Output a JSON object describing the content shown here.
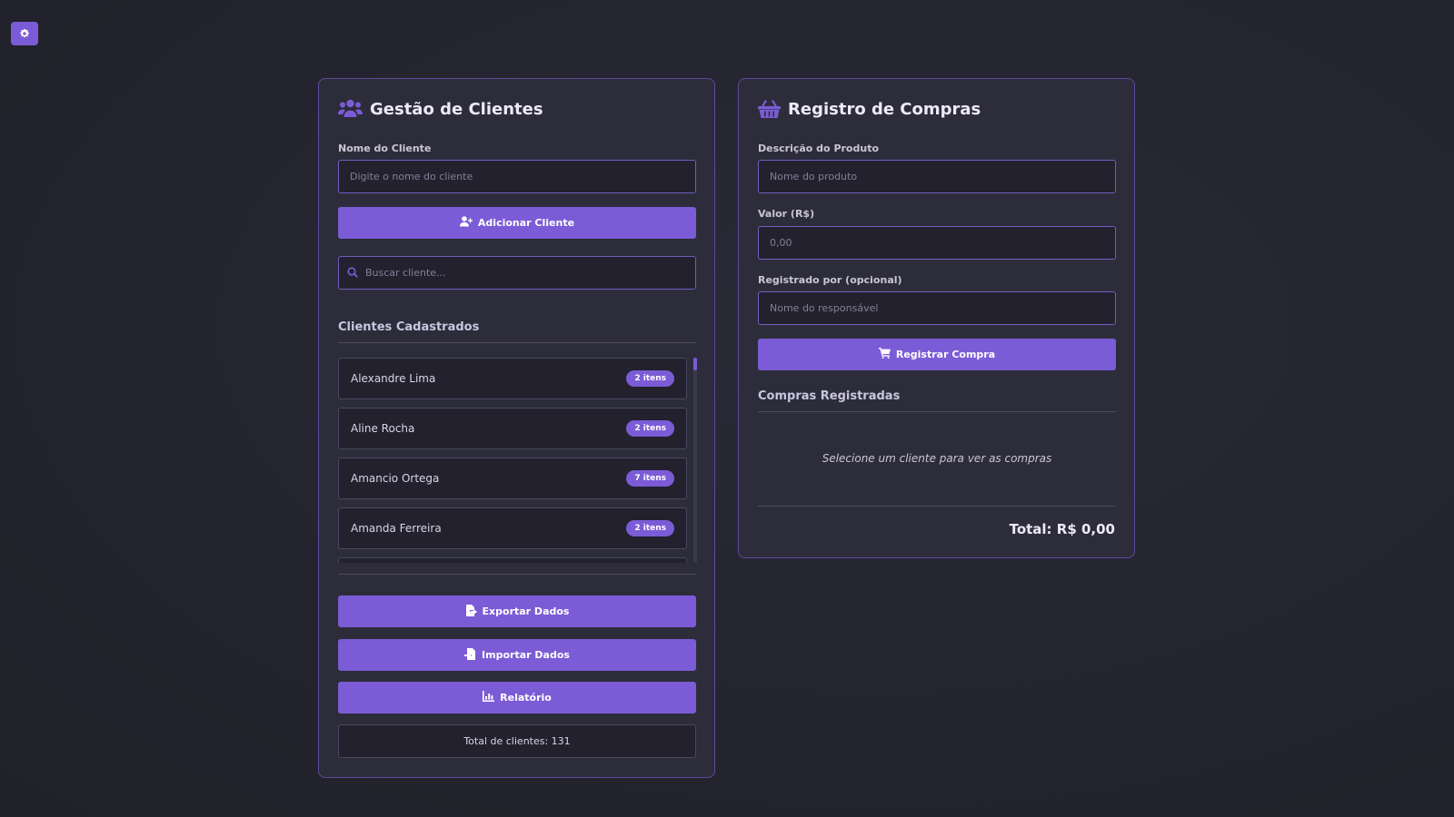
{
  "settings": {
    "icon": "gear-icon"
  },
  "clients_panel": {
    "title": "Gestão de Clientes",
    "title_icon": "users-icon",
    "name_label": "Nome do Cliente",
    "name_placeholder": "Digite o nome do cliente",
    "add_button": "Adicionar Cliente",
    "search_placeholder": "Buscar cliente...",
    "list_title": "Clientes Cadastrados",
    "clients": [
      {
        "name": "Alexandre Lima",
        "badge": "2 itens"
      },
      {
        "name": "Aline Rocha",
        "badge": "2 itens"
      },
      {
        "name": "Amancio Ortega",
        "badge": "7 itens"
      },
      {
        "name": "Amanda Ferreira",
        "badge": "2 itens"
      }
    ],
    "export_button": "Exportar Dados",
    "import_button": "Importar Dados",
    "report_button": "Relatório",
    "total_clients": "Total de clientes: 131"
  },
  "purchases_panel": {
    "title": "Registro de Compras",
    "title_icon": "basket-icon",
    "product_label": "Descrição do Produto",
    "product_placeholder": "Nome do produto",
    "value_label": "Valor (R$)",
    "value_placeholder": "0,00",
    "registered_by_label": "Registrado por (opcional)",
    "registered_by_placeholder": "Nome do responsável",
    "register_button": "Registrar Compra",
    "list_title": "Compras Registradas",
    "empty_message": "Selecione um cliente para ver as compras",
    "total": "Total: R$ 0,00"
  },
  "colors": {
    "accent": "#7b5cd6",
    "panel_bg": "#2d2c3a",
    "input_bg": "#22212d",
    "page_bg": "#24242f"
  }
}
